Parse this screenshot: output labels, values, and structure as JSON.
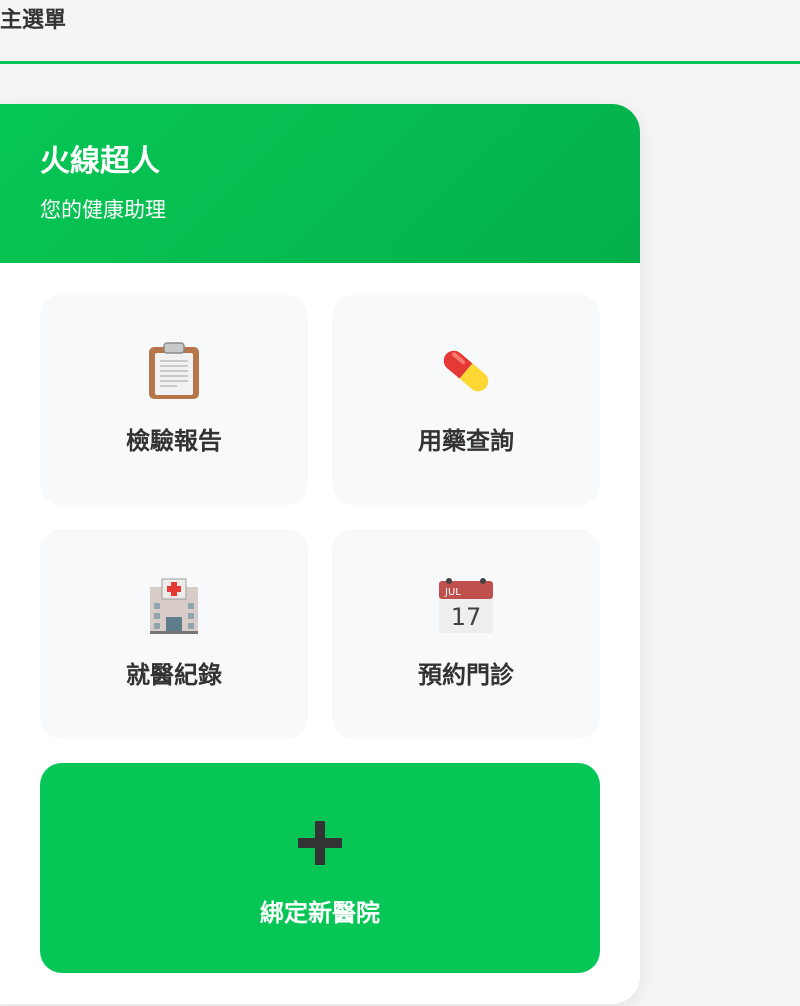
{
  "header": {
    "title": "主選單"
  },
  "brand": {
    "title": "火線超人",
    "subtitle": "您的健康助理"
  },
  "menu": {
    "items": [
      {
        "label": "檢驗報告",
        "icon": "clipboard-icon"
      },
      {
        "label": "用藥查詢",
        "icon": "pill-icon"
      },
      {
        "label": "就醫紀錄",
        "icon": "hospital-icon"
      },
      {
        "label": "預約門診",
        "icon": "calendar-icon"
      }
    ],
    "calendar_month": "JUL",
    "calendar_day": "17"
  },
  "bind_hospital": {
    "label": "綁定新醫院",
    "icon": "plus-icon"
  },
  "colors": {
    "accent": "#06c755",
    "tile_bg": "#f8f9fa",
    "text": "#333333"
  }
}
